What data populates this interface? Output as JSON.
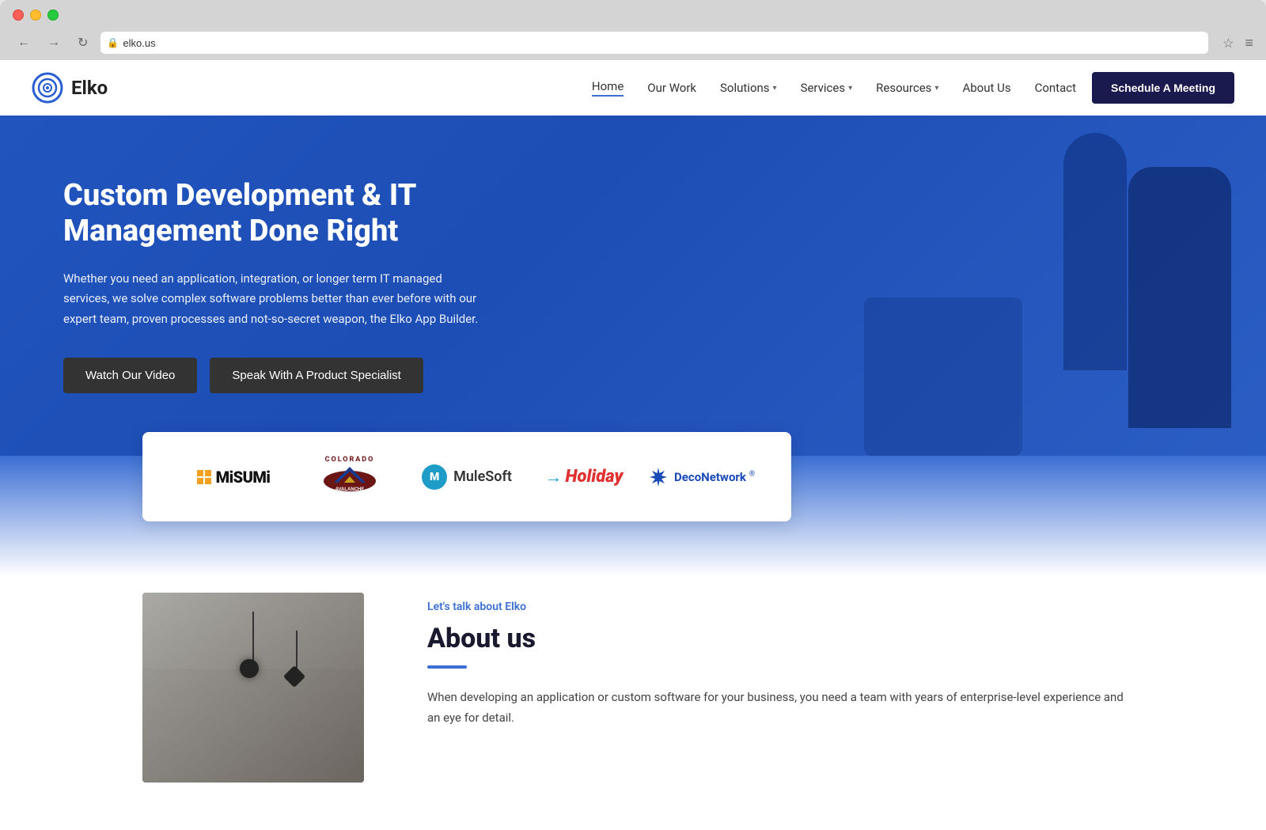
{
  "browser": {
    "address": "elko.us",
    "bookmark_icon": "☆",
    "menu_icon": "≡"
  },
  "navbar": {
    "logo_text": "Elko",
    "links": [
      {
        "label": "Home",
        "active": true,
        "has_dropdown": false
      },
      {
        "label": "Our Work",
        "active": false,
        "has_dropdown": false
      },
      {
        "label": "Solutions",
        "active": false,
        "has_dropdown": true
      },
      {
        "label": "Services",
        "active": false,
        "has_dropdown": true
      },
      {
        "label": "Resources",
        "active": false,
        "has_dropdown": true
      },
      {
        "label": "About Us",
        "active": false,
        "has_dropdown": false
      },
      {
        "label": "Contact",
        "active": false,
        "has_dropdown": false
      }
    ],
    "cta_label": "Schedule A Meeting"
  },
  "hero": {
    "title": "Custom Development & IT Management Done Right",
    "description": "Whether you need an application, integration, or longer term IT managed services, we solve complex software problems better than ever before with our expert team, proven processes and not-so-secret weapon, the Elko App Builder.",
    "btn_video": "Watch Our Video",
    "btn_specialist": "Speak With A Product Specialist"
  },
  "logos": {
    "items": [
      {
        "name": "MiSUMi",
        "type": "misumi"
      },
      {
        "name": "Colorado Avalanche",
        "type": "avalanche"
      },
      {
        "name": "MuleSoft",
        "type": "mulesoft"
      },
      {
        "name": "Holiday",
        "type": "holiday"
      },
      {
        "name": "DecoNetwork",
        "type": "deco"
      }
    ]
  },
  "about": {
    "eyebrow": "Let's talk about Elko",
    "title": "About us",
    "text": "When developing an application or custom software for your business, you need a team with years of enterprise-level experience and an eye for detail."
  }
}
